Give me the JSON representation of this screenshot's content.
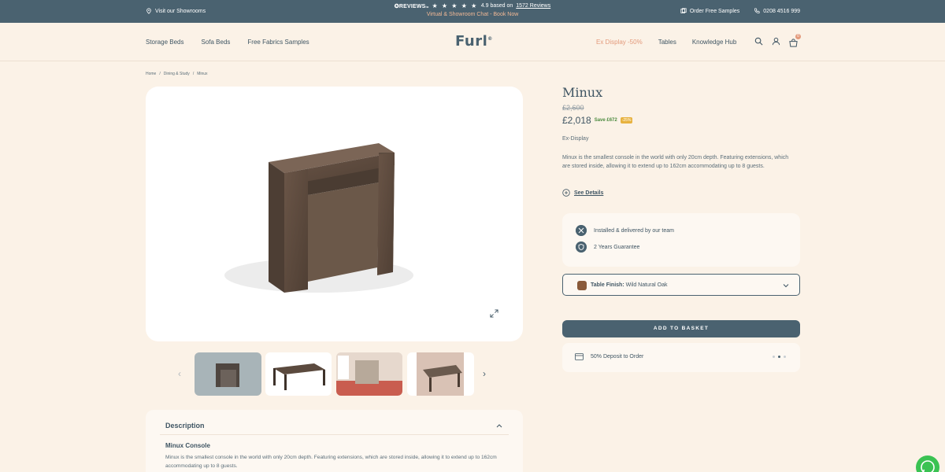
{
  "topbar": {
    "showrooms": "Visit our Showrooms",
    "reviews_logo": "REVIEWS",
    "reviews_logo_suffix": "io",
    "stars": "★ ★ ★ ★ ★",
    "rating_text": "4.9 based on",
    "reviews_link": "1572 Reviews",
    "promo": "Virtual & Showroom Chat - Book Now",
    "samples": "Order Free Samples",
    "phone": "0208 4516 999"
  },
  "nav": {
    "left": [
      "Storage Beds",
      "Sofa Beds",
      "Free Fabrics Samples"
    ],
    "logo": "Furl",
    "ex_display": "Ex Display -50%",
    "tables": "Tables",
    "knowledge": "Knowledge Hub",
    "cart_count": "0"
  },
  "breadcrumb": [
    "Home",
    "/",
    "Dining & Study",
    "/",
    "Minux"
  ],
  "product": {
    "title": "Minux",
    "old_price": "£2,600",
    "price": "£2,018",
    "save": "Save £672",
    "pct": "-25%",
    "condition": "Ex-Display",
    "description": "Minux is the smallest console in the world with only 20cm depth. Featuring extensions, which are stored inside, allowing it to extend up to 162cm accommodating up to 8 guests.",
    "see_details": "See Details"
  },
  "features": [
    "Installed & delivered by our team",
    "2 Years Guarantee"
  ],
  "finish": {
    "label": "Table Finish:",
    "value": "Wild Natural Oak",
    "swatch_color": "#8a5a3a"
  },
  "add_to_basket": "ADD TO BASKET",
  "deposit": "50% Deposit to Order",
  "description_section": {
    "title": "Description",
    "subtitle": "Minux Console",
    "text": "Minux is the smallest console in the world with only 20cm depth. Featuring extensions, which are stored inside, allowing it to extend up to 162cm accommodating up to 8 guests."
  },
  "colors": {
    "primary": "#4a6270",
    "accent": "#e39a7c",
    "background": "#fbf2e7",
    "whatsapp": "#3ac252"
  }
}
